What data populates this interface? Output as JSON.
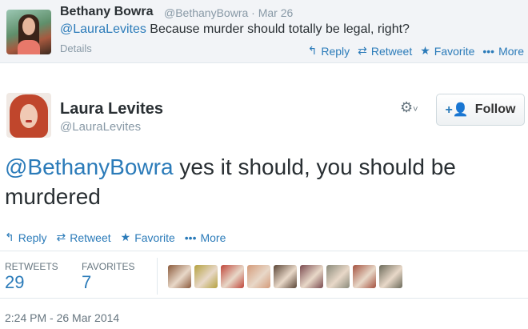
{
  "parent_tweet": {
    "author_name": "Bethany Bowra",
    "author_handle": "@BethanyBowra",
    "date": "· Mar 26",
    "mention": "@LauraLevites",
    "text": " Because murder should totally be legal, right?",
    "details_label": "Details",
    "actions": {
      "reply": "Reply",
      "retweet": "Retweet",
      "favorite": "Favorite",
      "more": "More"
    }
  },
  "main_tweet": {
    "author_name": "Laura Levites",
    "author_handle": "@LauraLevites",
    "follow_label": "Follow",
    "mention": "@BethanyBowra",
    "text": " yes it should, you should be murdered",
    "actions": {
      "reply": "Reply",
      "retweet": "Retweet",
      "favorite": "Favorite",
      "more": "More"
    },
    "stats": {
      "retweets_label": "RETWEETS",
      "retweets_value": "29",
      "favorites_label": "FAVORITES",
      "favorites_value": "7"
    },
    "favoriter_avatar_colors": [
      "#8b5a3c",
      "#b5a23f",
      "#c0463a",
      "#d49b7a",
      "#5a4536",
      "#7a4a4f",
      "#8a8a7a",
      "#a4513f",
      "#6b6a5a"
    ],
    "timestamp": "2:24 PM - 26 Mar 2014"
  },
  "colors": {
    "link": "#2b7bb9",
    "muted": "#8899a6",
    "text": "#292f33"
  }
}
